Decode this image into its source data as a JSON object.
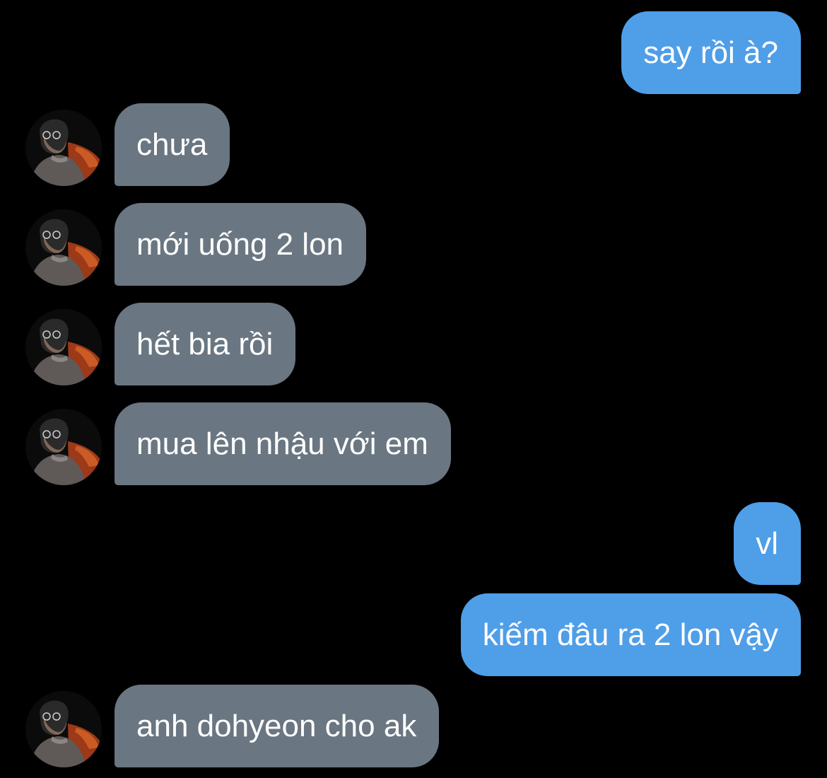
{
  "conversation": {
    "colors": {
      "background": "#000000",
      "incoming_bubble": "#6a7681",
      "outgoing_bubble": "#4f9ee8",
      "text": "#ffffff"
    },
    "contact_avatar_icon": "contact-photo-avatar",
    "messages": [
      {
        "direction": "outgoing",
        "text": "say rồi à?"
      },
      {
        "direction": "incoming",
        "text": "chưa"
      },
      {
        "direction": "incoming",
        "text": "mới uống 2 lon"
      },
      {
        "direction": "incoming",
        "text": "hết bia rồi"
      },
      {
        "direction": "incoming",
        "text": "mua lên nhậu với em"
      },
      {
        "direction": "outgoing",
        "text": "vl"
      },
      {
        "direction": "outgoing",
        "text": "kiếm đâu ra 2 lon vậy"
      },
      {
        "direction": "incoming",
        "text": "anh dohyeon cho ak"
      }
    ]
  }
}
